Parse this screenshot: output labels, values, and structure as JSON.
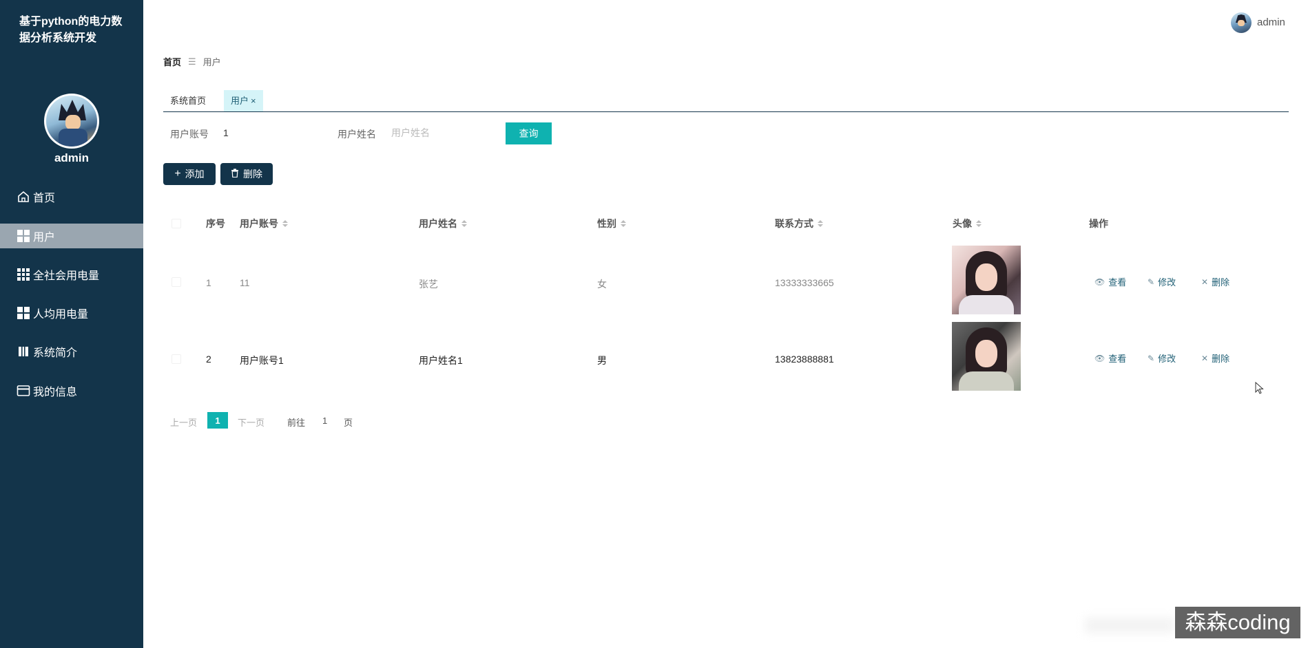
{
  "app": {
    "title": "基于python的电力数据分析系统开发"
  },
  "sidebar": {
    "username": "admin",
    "items": [
      {
        "label": "首页",
        "icon": "home-icon"
      },
      {
        "label": "用户",
        "icon": "grid-icon"
      },
      {
        "label": "全社会用电量",
        "icon": "grid9-icon"
      },
      {
        "label": "人均用电量",
        "icon": "grid-icon"
      },
      {
        "label": "系统简介",
        "icon": "book-icon"
      },
      {
        "label": "我的信息",
        "icon": "card-icon"
      }
    ]
  },
  "header": {
    "username": "admin"
  },
  "breadcrumb": {
    "home": "首页",
    "separator": "☰",
    "current": "用户"
  },
  "tabs": [
    {
      "label": "系统首页"
    },
    {
      "label": "用户",
      "close": "×"
    }
  ],
  "search": {
    "account_label": "用户账号",
    "account_value": "1",
    "name_label": "用户姓名",
    "name_placeholder": "用户姓名",
    "query_button": "查询"
  },
  "actions": {
    "add": "添加",
    "delete": "删除"
  },
  "table": {
    "headers": {
      "index": "序号",
      "account": "用户账号",
      "name": "用户姓名",
      "gender": "性别",
      "phone": "联系方式",
      "avatar": "头像",
      "operation": "操作"
    },
    "rows": [
      {
        "index": "1",
        "account": "11",
        "name": "张艺",
        "gender": "女",
        "phone": "13333333665"
      },
      {
        "index": "2",
        "account": "用户账号1",
        "name": "用户姓名1",
        "gender": "男",
        "phone": "13823888881"
      }
    ],
    "ops": {
      "view": "查看",
      "edit": "修改",
      "delete": "删除"
    }
  },
  "pagination": {
    "prev": "上一页",
    "current": "1",
    "next": "下一页",
    "goto": "前往",
    "page_value": "1",
    "page_unit": "页"
  },
  "watermark": "森森coding",
  "colors": {
    "sidebar": "#13344a",
    "accent": "#0fb2b0",
    "active_tab": "#d5f4f8",
    "active_menu": "#9aa6b0"
  }
}
